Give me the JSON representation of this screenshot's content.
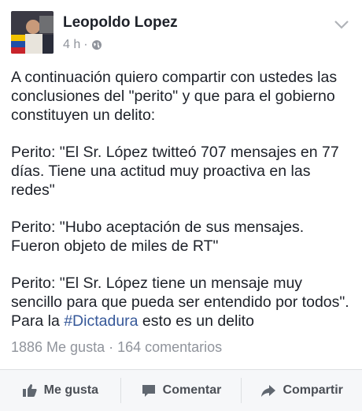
{
  "post": {
    "author": "Leopoldo Lopez",
    "time": "4 h",
    "separator": "·",
    "paragraphs": [
      "A continuación quiero compartir con ustedes las conclusiones del \"perito\" y que para el gobierno constituyen un delito:",
      "Perito: \"El Sr. López twitteó 707 mensajes en 77 días. Tiene una actitud muy proactiva en las redes\"",
      "Perito: \"Hubo aceptación de sus mensajes. Fueron objeto de miles de RT\""
    ],
    "last_paragraph": {
      "text_before": "Perito: \"El Sr. López tiene un mensaje muy sencillo para que pueda ser entendido por todos\". Para la ",
      "hashtag": "#Dictadura",
      "text_after": " esto es un delito"
    }
  },
  "stats": {
    "text": "1886 Me gusta · 164 comentarios"
  },
  "actions": {
    "like": "Me gusta",
    "comment": "Comentar",
    "share": "Compartir"
  },
  "icons": {
    "privacy": "globe-icon",
    "menu": "chevron-down-icon",
    "like": "thumbs-up-icon",
    "comment": "comment-icon",
    "share": "share-arrow-icon"
  },
  "colors": {
    "hashtag": "#365899",
    "meta": "#90949c",
    "text": "#1d2129"
  }
}
